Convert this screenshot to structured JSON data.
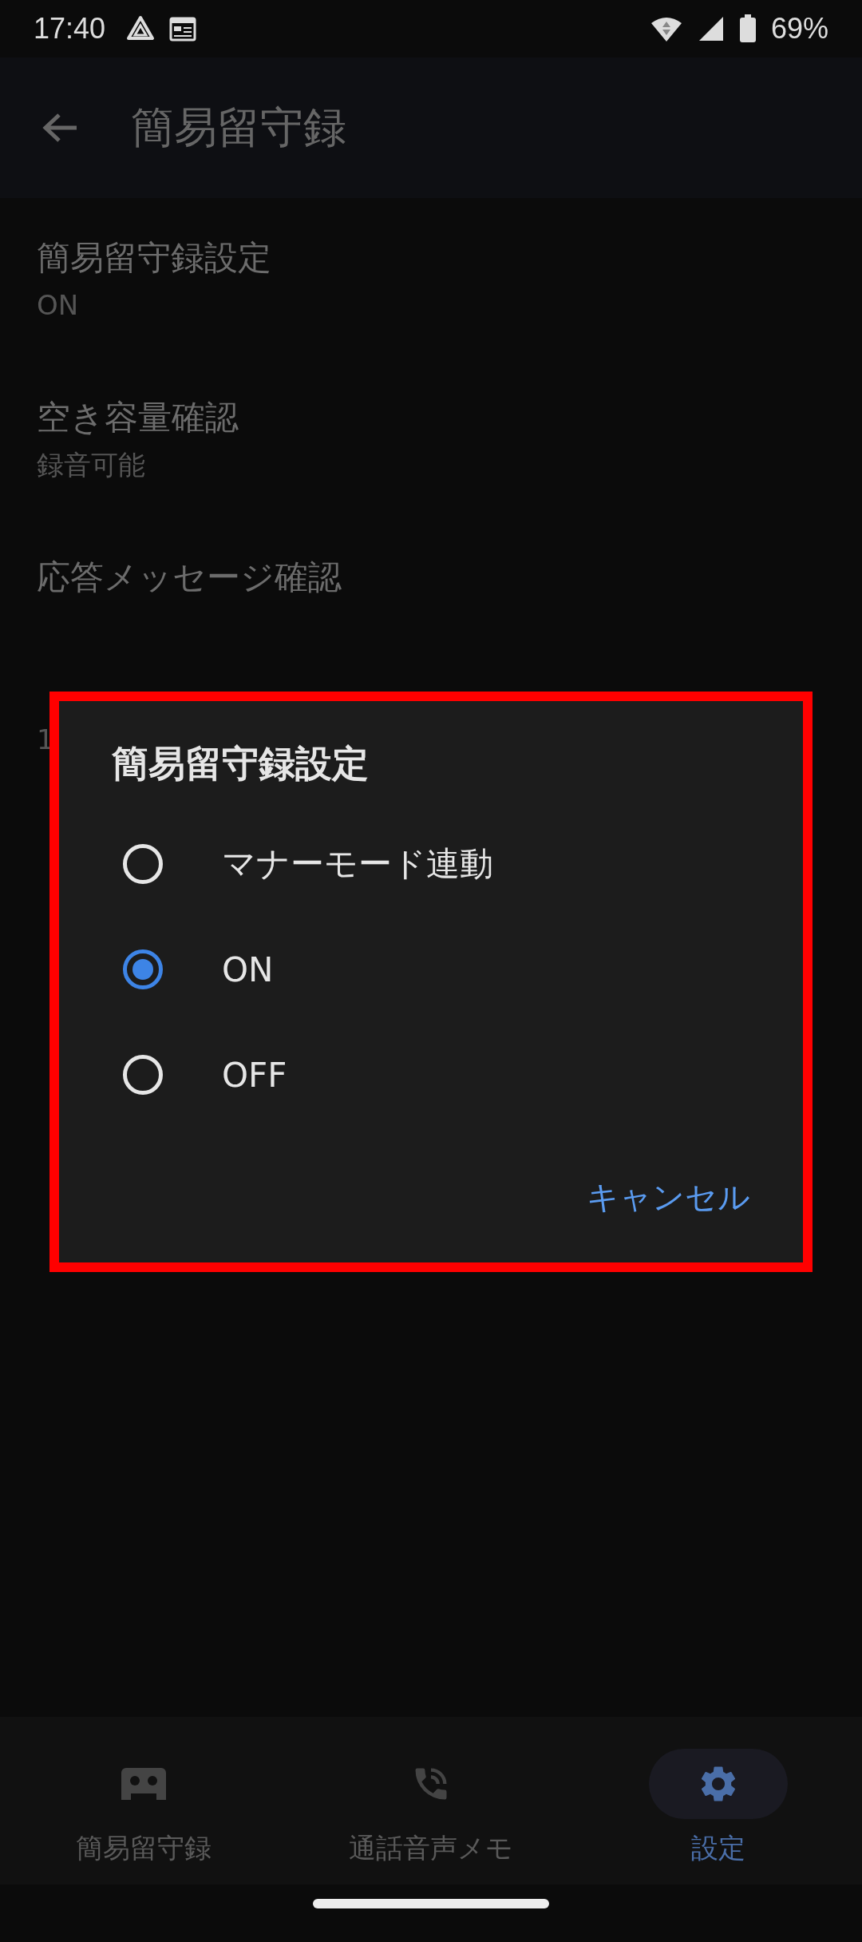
{
  "status_bar": {
    "time": "17:40",
    "battery": "69%"
  },
  "app_bar": {
    "title": "簡易留守録"
  },
  "settings": [
    {
      "title": "簡易留守録設定",
      "subtitle": "ON"
    },
    {
      "title": "空き容量確認",
      "subtitle": "録音可能"
    },
    {
      "title": "応答メッセージ確認"
    },
    {
      "subtitle": "1"
    }
  ],
  "dialog": {
    "title": "簡易留守録設定",
    "options": [
      {
        "label": "マナーモード連動",
        "selected": false
      },
      {
        "label": "ON",
        "selected": true
      },
      {
        "label": "OFF",
        "selected": false
      }
    ],
    "button": "キャンセル"
  },
  "nav": [
    {
      "label": "簡易留守録",
      "kind": "recorder",
      "selected": false
    },
    {
      "label": "通話音声メモ",
      "kind": "call",
      "selected": false
    },
    {
      "label": "設定",
      "kind": "settings",
      "selected": true
    }
  ]
}
